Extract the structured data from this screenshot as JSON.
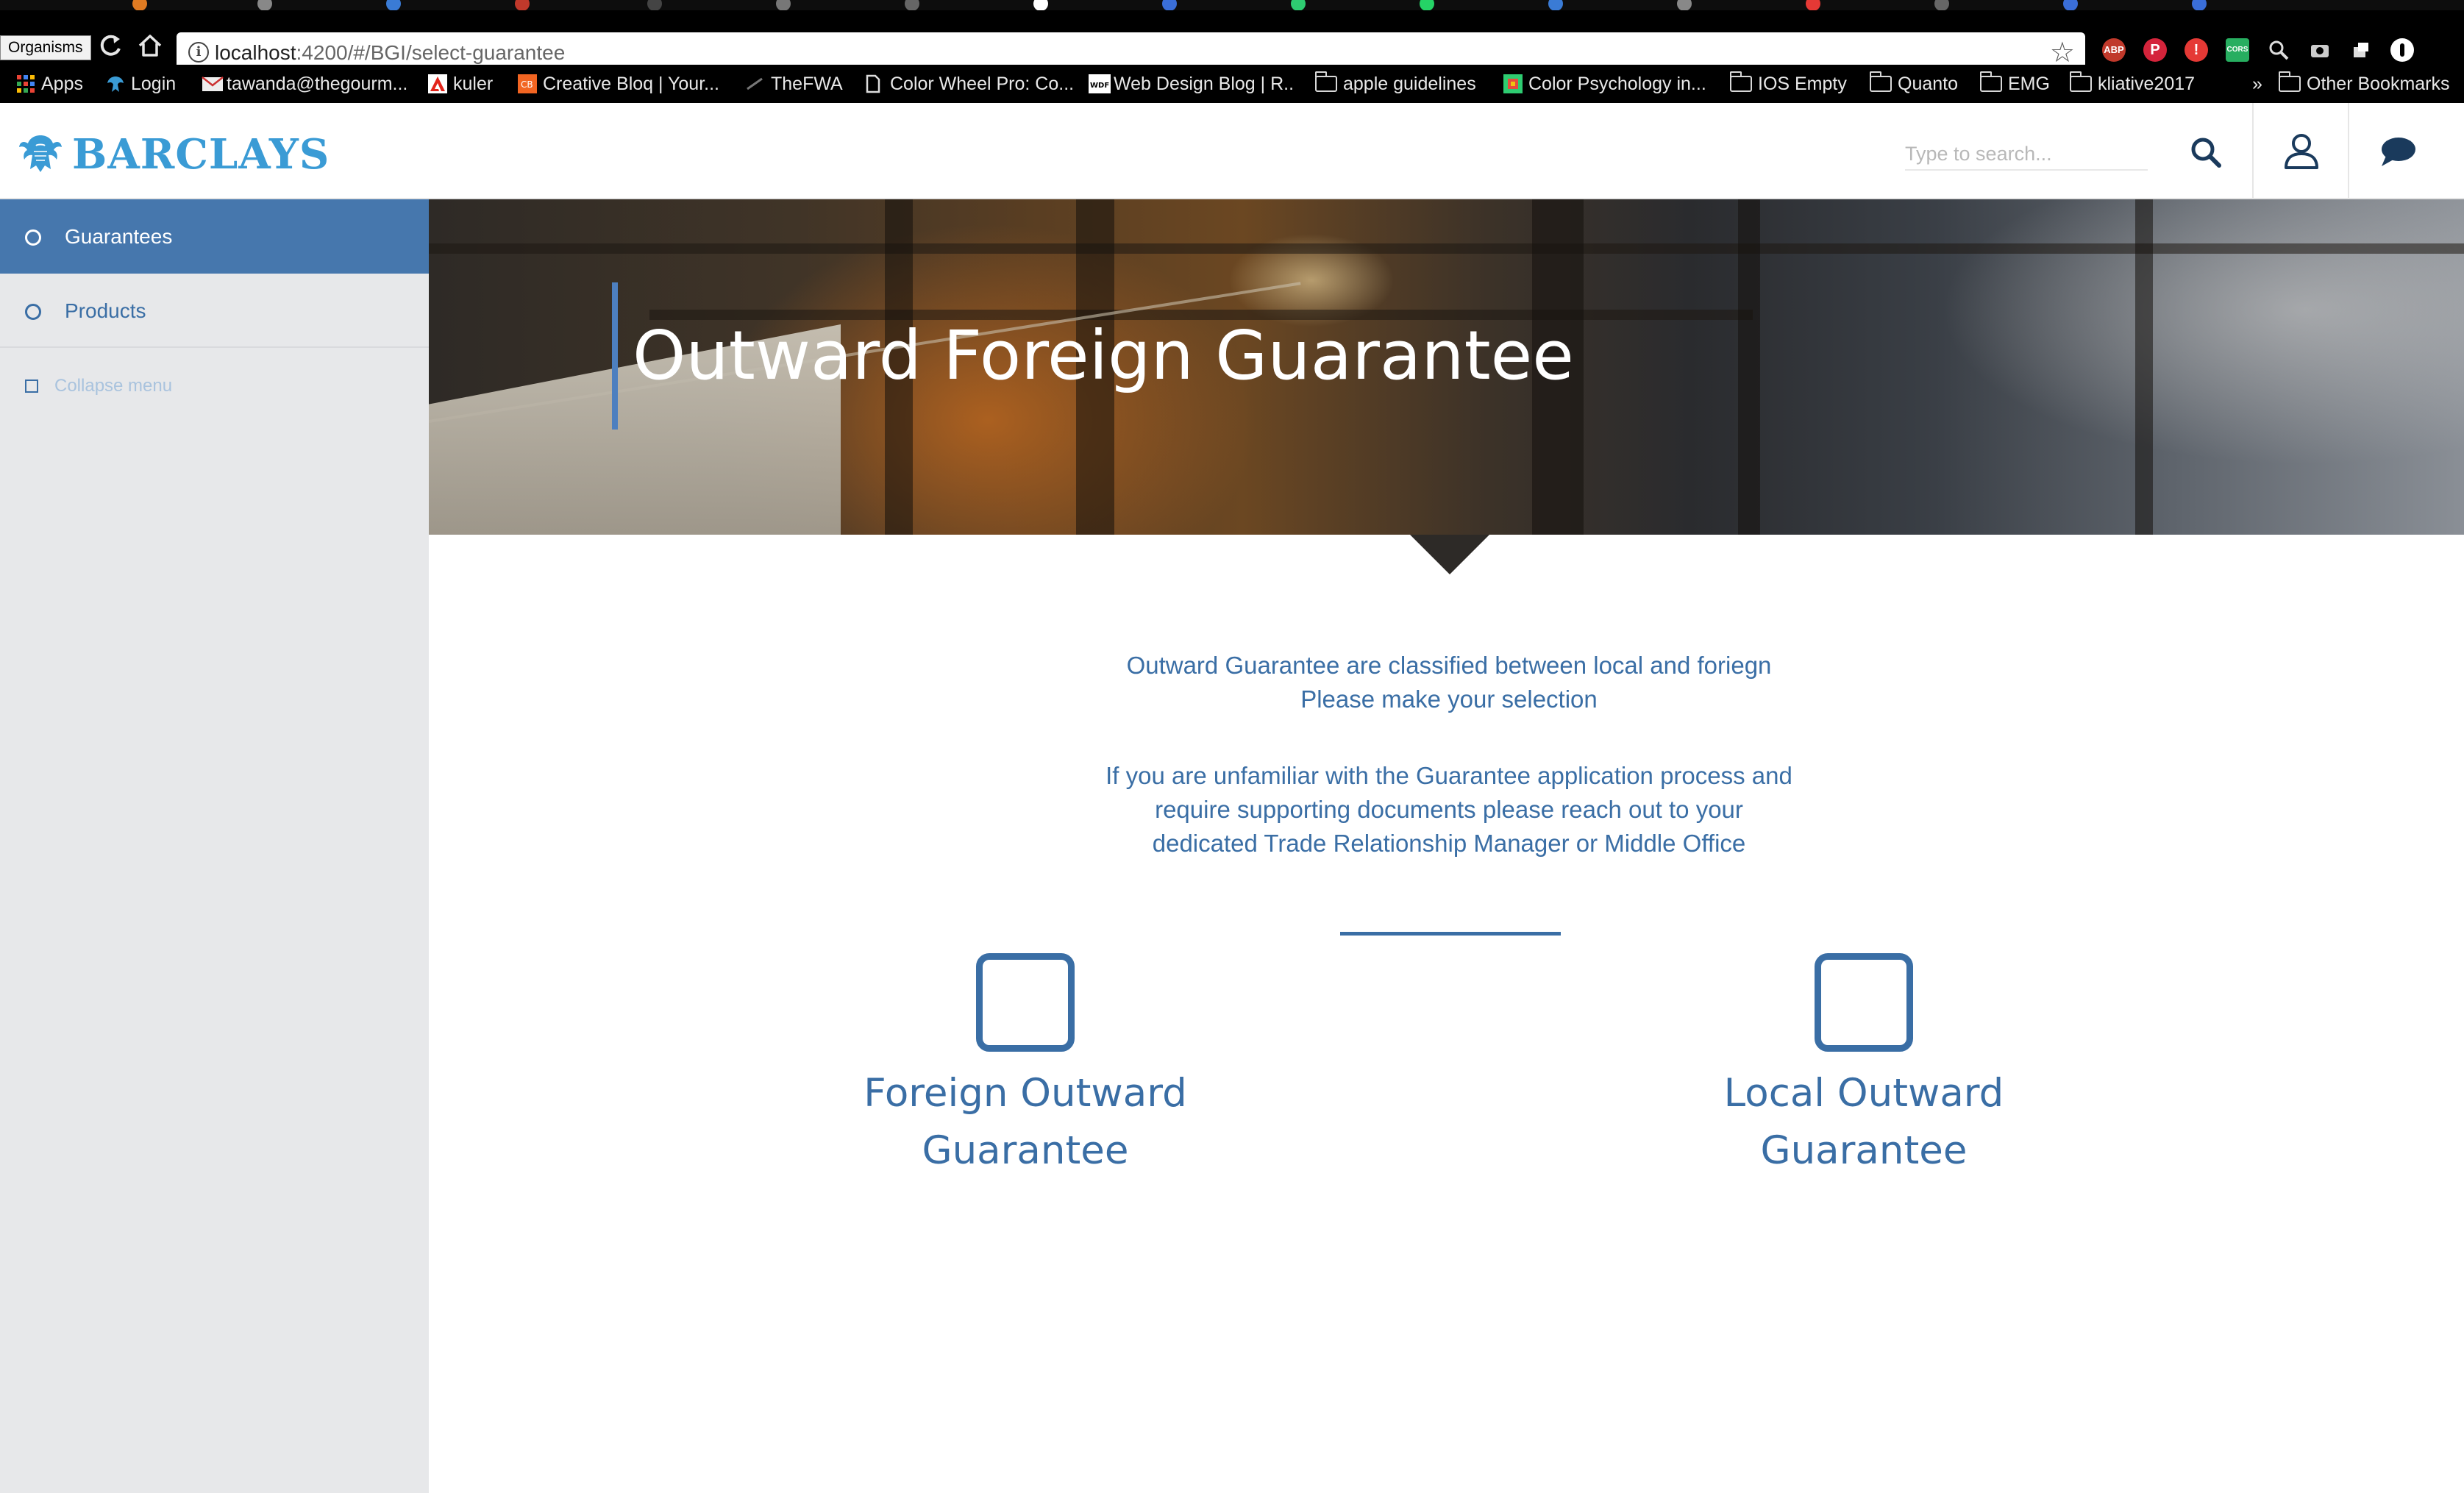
{
  "browser": {
    "tooltip": "Organisms",
    "url_host": "localhost",
    "url_rest": ":4200/#/BGI/select-guarantee",
    "extensions": [
      "ABP",
      "P",
      "!",
      "CORS"
    ],
    "bookmarks": [
      {
        "label": "Apps",
        "icon": "apps-grid-icon"
      },
      {
        "label": "Login",
        "icon": "barclays-eagle-icon"
      },
      {
        "label": "tawanda@thegourm...",
        "icon": "mail-icon"
      },
      {
        "label": "kuler",
        "icon": "adobe-icon"
      },
      {
        "label": "Creative Bloq | Your...",
        "icon": "creative-bloq-icon"
      },
      {
        "label": "TheFWA",
        "icon": "fwa-icon"
      },
      {
        "label": "Color Wheel Pro: Co...",
        "icon": "page-icon"
      },
      {
        "label": "Web Design Blog | R..",
        "icon": "wdf-icon"
      },
      {
        "label": "apple guidelines",
        "icon": "folder-icon"
      },
      {
        "label": "Color Psychology in...",
        "icon": "color-psych-icon"
      },
      {
        "label": "IOS Empty",
        "icon": "folder-icon"
      },
      {
        "label": "Quanto",
        "icon": "folder-icon"
      },
      {
        "label": "EMG",
        "icon": "folder-icon"
      },
      {
        "label": "kliative2017",
        "icon": "folder-icon"
      }
    ],
    "overflow": "»",
    "other_bookmarks": "Other Bookmarks"
  },
  "header": {
    "brand": "BARCLAYS",
    "search_placeholder": "Type to search..."
  },
  "sidebar": {
    "items": [
      {
        "label": "Guarantees",
        "active": true
      },
      {
        "label": "Products",
        "active": false
      }
    ],
    "collapse_label": "Collapse menu"
  },
  "hero": {
    "title": "Outward Foreign Guarantee"
  },
  "main": {
    "intro_line1": "Outward Guarantee are classified between local and foriegn",
    "intro_line2": "Please make your selection",
    "help_line1": "If you are unfamiliar with the Guarantee application process and",
    "help_line2": "require supporting documents please reach out to your",
    "help_line3": "dedicated Trade Relationship Manager or Middle Office",
    "options": [
      {
        "line1": "Foreign Outward",
        "line2": "Guarantee"
      },
      {
        "line1": "Local Outward",
        "line2": "Guarantee"
      }
    ]
  },
  "colors": {
    "brand_blue": "#3a9bd5",
    "accent_blue": "#3a6ea5",
    "sidebar_active": "#4677ad",
    "sidebar_bg": "#e7e8ea"
  }
}
